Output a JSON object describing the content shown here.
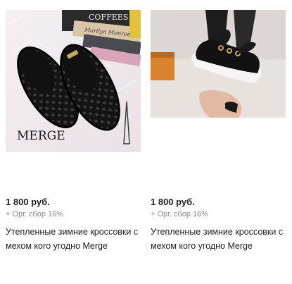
{
  "products": [
    {
      "price": "1 800 руб.",
      "fee": "+ Орг. сбор 16%",
      "title": "Утепленные зимние кроссовки с мехом кого угодно Merge",
      "photo_watermark": "MERGE"
    },
    {
      "price": "1 800 руб.",
      "fee": "+ Орг. сбор 16%",
      "title": "Утепленные зимние кроссовки с мехом кого угодно Merge"
    }
  ]
}
